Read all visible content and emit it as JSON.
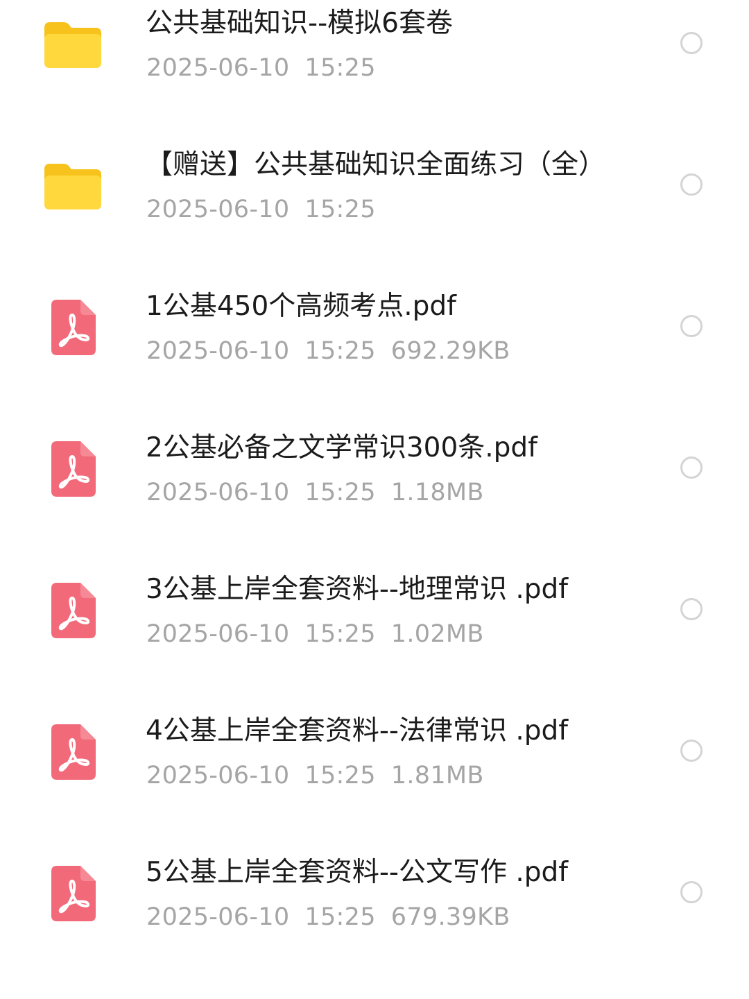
{
  "files": [
    {
      "type": "folder",
      "icon": "folder-icon",
      "name": "公共基础知识--模拟6套卷",
      "date": "2025-06-10",
      "time": "15:25",
      "size": ""
    },
    {
      "type": "folder",
      "icon": "folder-icon",
      "name": "【赠送】公共基础知识全面练习（全）",
      "date": "2025-06-10",
      "time": "15:25",
      "size": ""
    },
    {
      "type": "pdf",
      "icon": "pdf-icon",
      "name": "1公基450个高频考点.pdf",
      "date": "2025-06-10",
      "time": "15:25",
      "size": "692.29KB"
    },
    {
      "type": "pdf",
      "icon": "pdf-icon",
      "name": "2公基必备之文学常识300条.pdf",
      "date": "2025-06-10",
      "time": "15:25",
      "size": "1.18MB"
    },
    {
      "type": "pdf",
      "icon": "pdf-icon",
      "name": "3公基上岸全套资料--地理常识 .pdf",
      "date": "2025-06-10",
      "time": "15:25",
      "size": "1.02MB"
    },
    {
      "type": "pdf",
      "icon": "pdf-icon",
      "name": "4公基上岸全套资料--法律常识 .pdf",
      "date": "2025-06-10",
      "time": "15:25",
      "size": "1.81MB"
    },
    {
      "type": "pdf",
      "icon": "pdf-icon",
      "name": "5公基上岸全套资料--公文写作 .pdf",
      "date": "2025-06-10",
      "time": "15:25",
      "size": "679.39KB"
    }
  ],
  "colors": {
    "folder_back": "#f7c21b",
    "folder_front": "#ffd83d",
    "pdf_icon": "#f26a79",
    "title_text": "#1b1b1b",
    "meta_text": "#a5a5a5",
    "radio_border": "#d4d4d4"
  }
}
